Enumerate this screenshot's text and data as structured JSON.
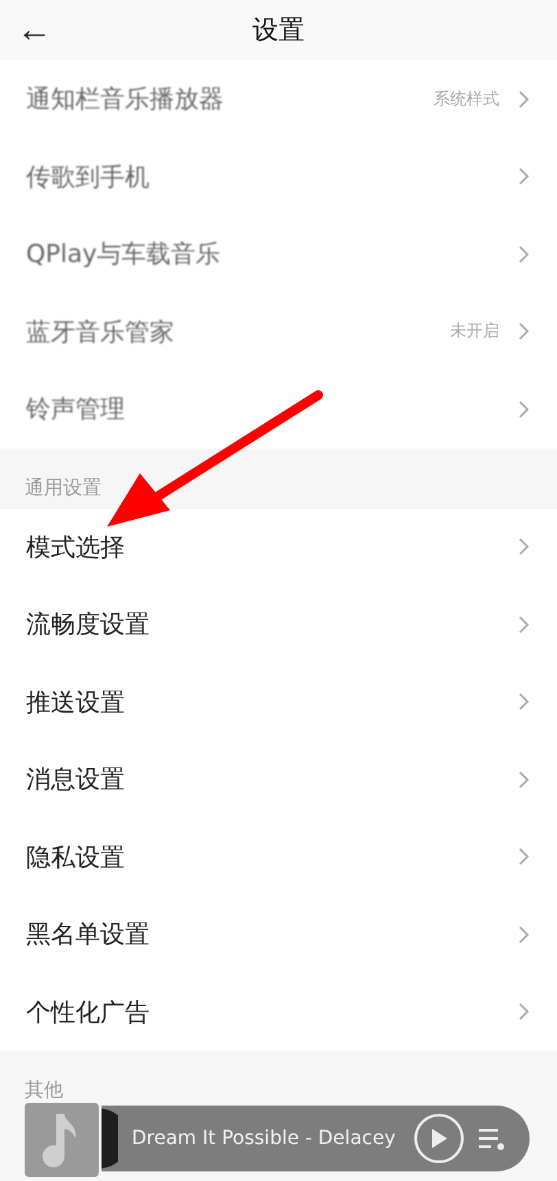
{
  "header": {
    "back": "←",
    "title": "设置"
  },
  "sections": [
    {
      "items": [
        {
          "label": "通知栏音乐播放器",
          "value": "系统样式"
        },
        {
          "label": "传歌到手机"
        },
        {
          "label": "QPlay与车载音乐"
        },
        {
          "label": "蓝牙音乐管家",
          "value": "未开启"
        },
        {
          "label": "铃声管理"
        }
      ]
    },
    {
      "title": "通用设置",
      "items": [
        {
          "label": "模式选择"
        },
        {
          "label": "流畅度设置"
        },
        {
          "label": "推送设置"
        },
        {
          "label": "消息设置"
        },
        {
          "label": "隐私设置"
        },
        {
          "label": "黑名单设置"
        },
        {
          "label": "个性化广告"
        }
      ]
    },
    {
      "title": "其他"
    }
  ],
  "player": {
    "track": "Dream It Possible - Delacey"
  }
}
